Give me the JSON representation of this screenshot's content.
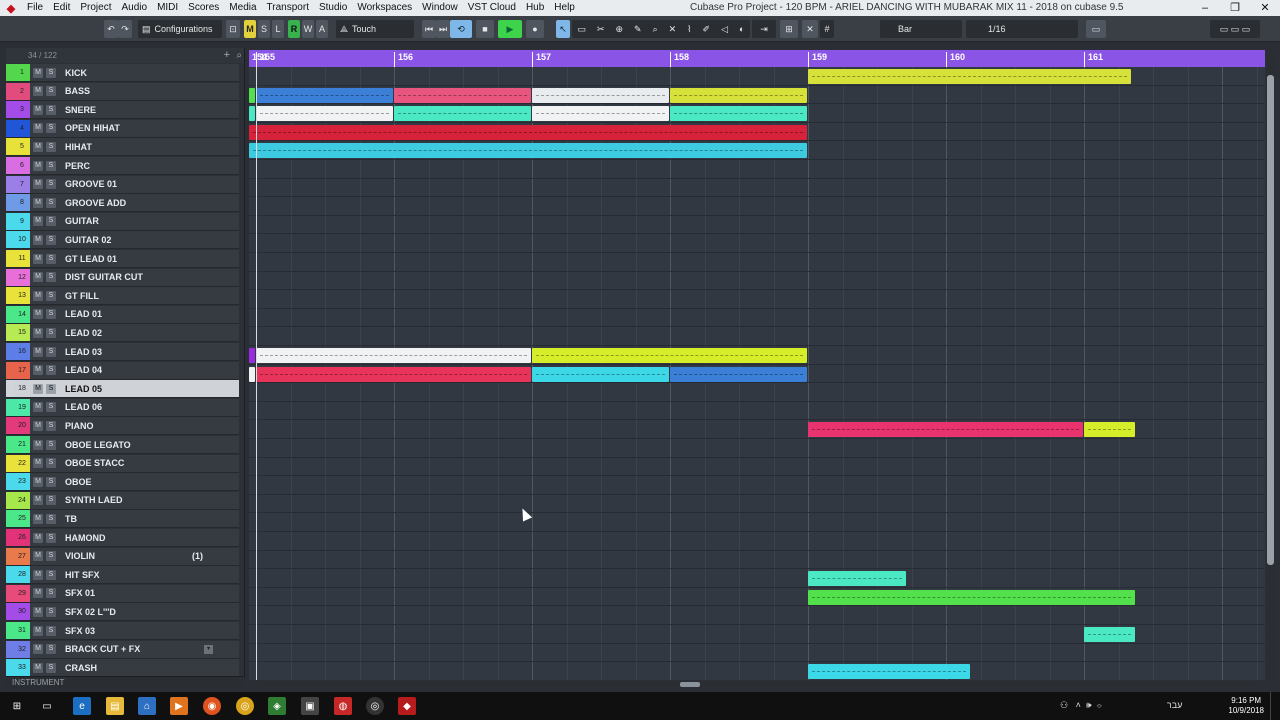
{
  "menubar": {
    "items": [
      "File",
      "Edit",
      "Project",
      "Audio",
      "MIDI",
      "Scores",
      "Media",
      "Transport",
      "Studio",
      "Workspaces",
      "Window",
      "VST Cloud",
      "Hub",
      "Help"
    ],
    "title": "Cubase Pro Project - 120 BPM - ARIEL DANCING WITH MUBARAK MIX 11 - 2018 on cubase 9.5"
  },
  "toolbar": {
    "configurations": "Configurations",
    "touch_mode": "Touch",
    "snap_type": "Bar",
    "quantize": "1/16",
    "mode_buttons": [
      "M",
      "S",
      "L",
      "R",
      "W",
      "A"
    ]
  },
  "track_panel": {
    "count": "34 / 122",
    "footer": "INSTRUMENT"
  },
  "tracks": [
    {
      "num": "1",
      "name": "KICK",
      "color": "#53d84d"
    },
    {
      "num": "2",
      "name": "BASS",
      "color": "#e14b7d"
    },
    {
      "num": "3",
      "name": "SNERE",
      "color": "#a44ce8"
    },
    {
      "num": "4",
      "name": "OPEN HIHAT",
      "color": "#2256d8"
    },
    {
      "num": "5",
      "name": "HIHAT",
      "color": "#e7e23a"
    },
    {
      "num": "6",
      "name": "PERC",
      "color": "#d86ee2"
    },
    {
      "num": "7",
      "name": "GROOVE 01",
      "color": "#9b7ee6"
    },
    {
      "num": "8",
      "name": "GROOVE ADD",
      "color": "#6f9ae6"
    },
    {
      "num": "9",
      "name": "GUITAR",
      "color": "#4bd9ec"
    },
    {
      "num": "10",
      "name": "GUITAR 02",
      "color": "#4bd9ec"
    },
    {
      "num": "11",
      "name": "GT LEAD 01",
      "color": "#e8e23a"
    },
    {
      "num": "12",
      "name": "DIST GUITAR CUT",
      "color": "#e86fd8"
    },
    {
      "num": "13",
      "name": "GT FILL",
      "color": "#e8e23a"
    },
    {
      "num": "14",
      "name": "LEAD 01",
      "color": "#4be88a"
    },
    {
      "num": "15",
      "name": "LEAD 02",
      "color": "#b8ea54"
    },
    {
      "num": "16",
      "name": "LEAD 03",
      "color": "#5c7ee6"
    },
    {
      "num": "17",
      "name": "LEAD 04",
      "color": "#e8634b"
    },
    {
      "num": "18",
      "name": "LEAD 05",
      "color": "#d1d5da"
    },
    {
      "num": "19",
      "name": "LEAD 06",
      "color": "#4be8a8"
    },
    {
      "num": "20",
      "name": "PIANO",
      "color": "#e23a7a"
    },
    {
      "num": "21",
      "name": "OBOE LEGATO",
      "color": "#4be88a"
    },
    {
      "num": "22",
      "name": "OBOE STACC",
      "color": "#e8e23a"
    },
    {
      "num": "23",
      "name": "OBOE",
      "color": "#4bd9ec"
    },
    {
      "num": "24",
      "name": "SYNTH LAED",
      "color": "#a6e84b"
    },
    {
      "num": "25",
      "name": "TB",
      "color": "#4be88a"
    },
    {
      "num": "26",
      "name": "HAMOND",
      "color": "#e2337a"
    },
    {
      "num": "27",
      "name": "VIOLIN",
      "color": "#e87a4b",
      "extra": "(1)"
    },
    {
      "num": "28",
      "name": "HIT SFX",
      "color": "#4bd9ec"
    },
    {
      "num": "29",
      "name": "SFX 01",
      "color": "#e84b7a"
    },
    {
      "num": "30",
      "name": "SFX 02 L'''D",
      "color": "#a44ce8"
    },
    {
      "num": "31",
      "name": "SFX 03",
      "color": "#4be88a"
    },
    {
      "num": "32",
      "name": "BRACK CUT + FX",
      "color": "#6f7ee6"
    },
    {
      "num": "33",
      "name": "CRASH",
      "color": "#4bd9ec"
    }
  ],
  "ruler": {
    "bars": [
      "154",
      "155",
      "156",
      "157",
      "158",
      "159",
      "160",
      "161"
    ]
  },
  "clips": [
    {
      "track": 0,
      "start": 159,
      "end": 161.35,
      "color": "#d6e23a"
    },
    {
      "track": 1,
      "start": 154,
      "end": 155,
      "color": "#53e04d"
    },
    {
      "track": 1,
      "start": 155,
      "end": 156,
      "color": "#3b7fd6"
    },
    {
      "track": 1,
      "start": 156,
      "end": 157,
      "color": "#e8557f"
    },
    {
      "track": 1,
      "start": 157,
      "end": 158,
      "color": "#e8ecef"
    },
    {
      "track": 1,
      "start": 158,
      "end": 159,
      "color": "#d6e23a"
    },
    {
      "track": 2,
      "start": 154,
      "end": 155,
      "color": "#4be8c4"
    },
    {
      "track": 2,
      "start": 155,
      "end": 156,
      "color": "#f0f2f4"
    },
    {
      "track": 2,
      "start": 156,
      "end": 157,
      "color": "#4be8c4"
    },
    {
      "track": 2,
      "start": 157,
      "end": 158,
      "color": "#f0f2f4"
    },
    {
      "track": 2,
      "start": 158,
      "end": 159,
      "color": "#4be8c4"
    },
    {
      "track": 3,
      "start": 154,
      "end": 159,
      "color": "#d6223a"
    },
    {
      "track": 4,
      "start": 154,
      "end": 159,
      "color": "#3ccbe0"
    },
    {
      "track": 15,
      "start": 154,
      "end": 155,
      "color": "#9b2be0"
    },
    {
      "track": 15,
      "start": 155,
      "end": 157,
      "color": "#f0f2f4"
    },
    {
      "track": 15,
      "start": 157,
      "end": 159,
      "color": "#d6ee2a"
    },
    {
      "track": 16,
      "start": 154,
      "end": 155,
      "color": "#f0f2f4"
    },
    {
      "track": 16,
      "start": 155,
      "end": 157,
      "color": "#e8335a"
    },
    {
      "track": 16,
      "start": 157,
      "end": 158,
      "color": "#3cd8e8"
    },
    {
      "track": 16,
      "start": 158,
      "end": 159,
      "color": "#3b7fd6"
    },
    {
      "track": 19,
      "start": 159,
      "end": 161,
      "color": "#e8336f"
    },
    {
      "track": 19,
      "start": 161,
      "end": 161.38,
      "color": "#d6ee2a"
    },
    {
      "track": 27,
      "start": 159,
      "end": 159.72,
      "color": "#4be8c4"
    },
    {
      "track": 28,
      "start": 159,
      "end": 161.38,
      "color": "#53e04d"
    },
    {
      "track": 30,
      "start": 161,
      "end": 161.38,
      "color": "#4be8c4"
    },
    {
      "track": 32,
      "start": 159,
      "end": 160.18,
      "color": "#3cd8e8"
    }
  ],
  "taskbar": {
    "time": "9:16 PM",
    "date": "10/9/2018",
    "lang": "עבר"
  }
}
